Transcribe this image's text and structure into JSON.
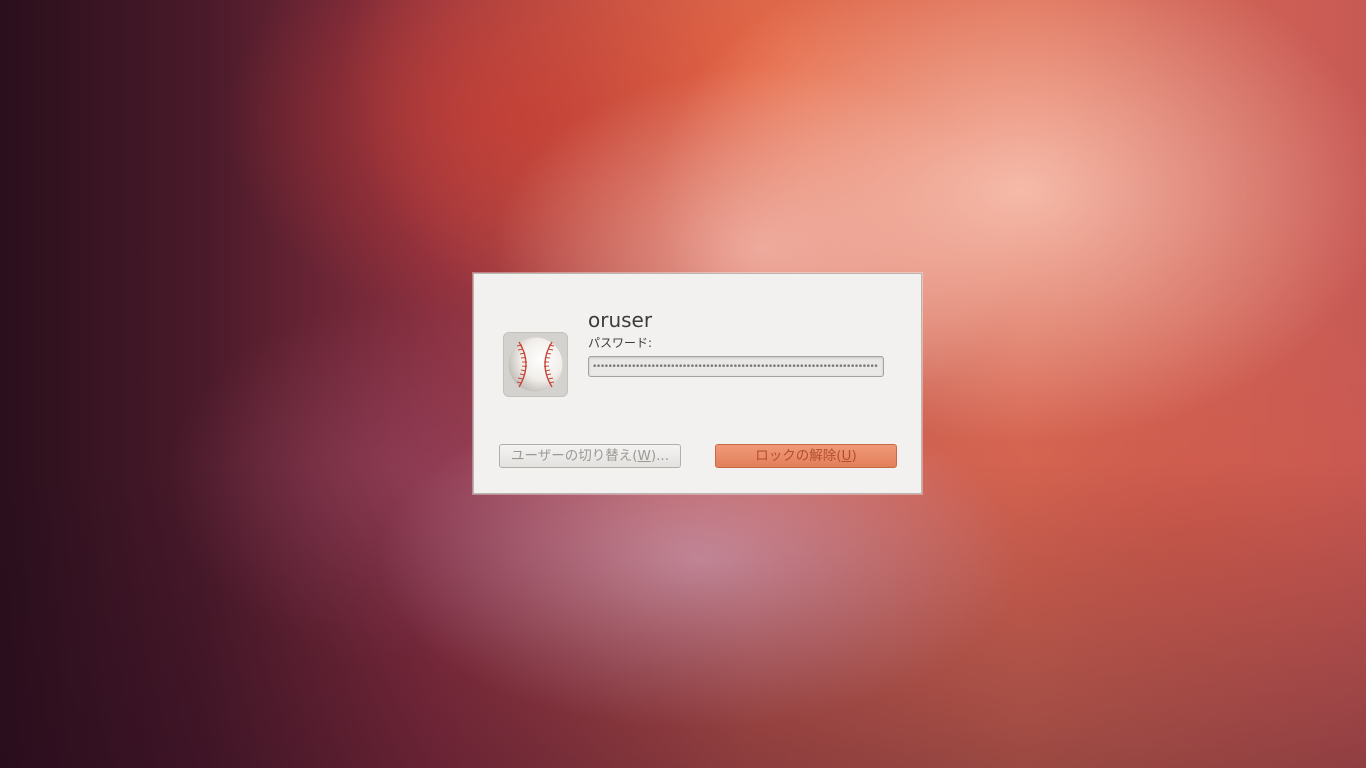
{
  "dialog": {
    "username": "oruser",
    "password_label": "パスワード:",
    "password_mask": "•••••••••••••••••••••••••••••••••••••••••••••••••••••••••••••••••••••••••",
    "avatar_icon": "baseball-icon"
  },
  "buttons": {
    "switch_user_prefix": "ユーザーの切り替え(",
    "switch_user_mnemonic": "W",
    "switch_user_suffix": ")...",
    "unlock_prefix": "ロックの解除(",
    "unlock_mnemonic": "U",
    "unlock_suffix": ")"
  },
  "colors": {
    "dialog_bg": "#f2f1f0",
    "unlock_button": "#e8876a"
  }
}
